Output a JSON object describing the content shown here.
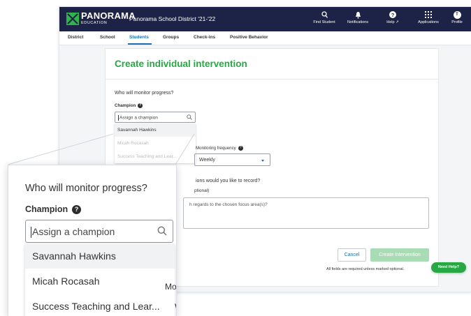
{
  "topbar": {
    "logo_text": "PANORAMA",
    "logo_sub": "EDUCATION",
    "district": "Panorama School District '21-'22",
    "nav": [
      {
        "label": "Find Student",
        "icon": "search-icon"
      },
      {
        "label": "Notifications",
        "icon": "bell-icon"
      },
      {
        "label": "Help ↗",
        "icon": "help-icon"
      },
      {
        "label": "Applications",
        "icon": "grid-icon"
      },
      {
        "label": "Profile",
        "icon": "avatar",
        "initials": "T"
      }
    ]
  },
  "subnav": {
    "tabs": [
      "District",
      "School",
      "Students",
      "Groups",
      "Check-ins",
      "Positive Behavior"
    ],
    "active": "Students"
  },
  "form": {
    "title": "Create individual intervention",
    "monitor_question": "Who will monitor progress?",
    "champion_label": "Champion",
    "champion_placeholder": "Assign a champion",
    "champion_options": [
      "Savannah Hawkins",
      "Micah Rocasah",
      "Success Teaching and Lear..."
    ],
    "monitoring_frequency_label": "Monitoring frequency",
    "monitoring_frequency_value": "Weekly",
    "actions_question": "ions would you like to record?",
    "optional_label": "ptional)",
    "notes_placeholder": "h regards to the chosen focus area(s)?",
    "cancel_label": "Cancel",
    "create_label": "Create Intervention",
    "required_note": "All fields are required unless marked optional."
  },
  "help_button": "Need Help?",
  "zoom": {
    "monitor_question": "Who will monitor progress?",
    "champion_label": "Champion",
    "placeholder": "Assign a champion",
    "options": [
      "Savannah Hawkins",
      "Micah Rocasah",
      "Success Teaching and Lear..."
    ],
    "partial_mon": "Mon",
    "partial_we": "We"
  },
  "colors": {
    "navy": "#1d2346",
    "accent_green": "#28a745",
    "link_blue": "#1c6fb5",
    "disabled_green": "#a9dcb4"
  }
}
